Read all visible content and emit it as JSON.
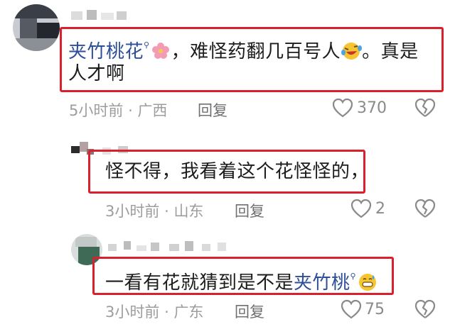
{
  "comments": [
    {
      "link": "夹竹桃花",
      "text_after": "，难怪药翻几百号人",
      "text_end": "。真是",
      "line2": "人才啊",
      "emoji": [
        "flower",
        "laugh-cry"
      ],
      "time": "5小时前",
      "location": "广西",
      "reply_label": "回复",
      "likes": "370"
    },
    {
      "text": "怪不得，我看着这个花怪怪的，",
      "time": "3小时前",
      "location": "山东",
      "reply_label": "回复",
      "likes": "2"
    },
    {
      "text_before": "一看有花就猜到是不是",
      "link": "夹竹桃",
      "emoji": [
        "grin-sweat"
      ],
      "time": "3小时前",
      "location": "广东",
      "reply_label": "回复",
      "likes": "75"
    }
  ],
  "meta_separator": "·",
  "colors": {
    "highlight": "#d9202c",
    "link": "#2d4f9a",
    "meta": "#9d9d9d"
  }
}
